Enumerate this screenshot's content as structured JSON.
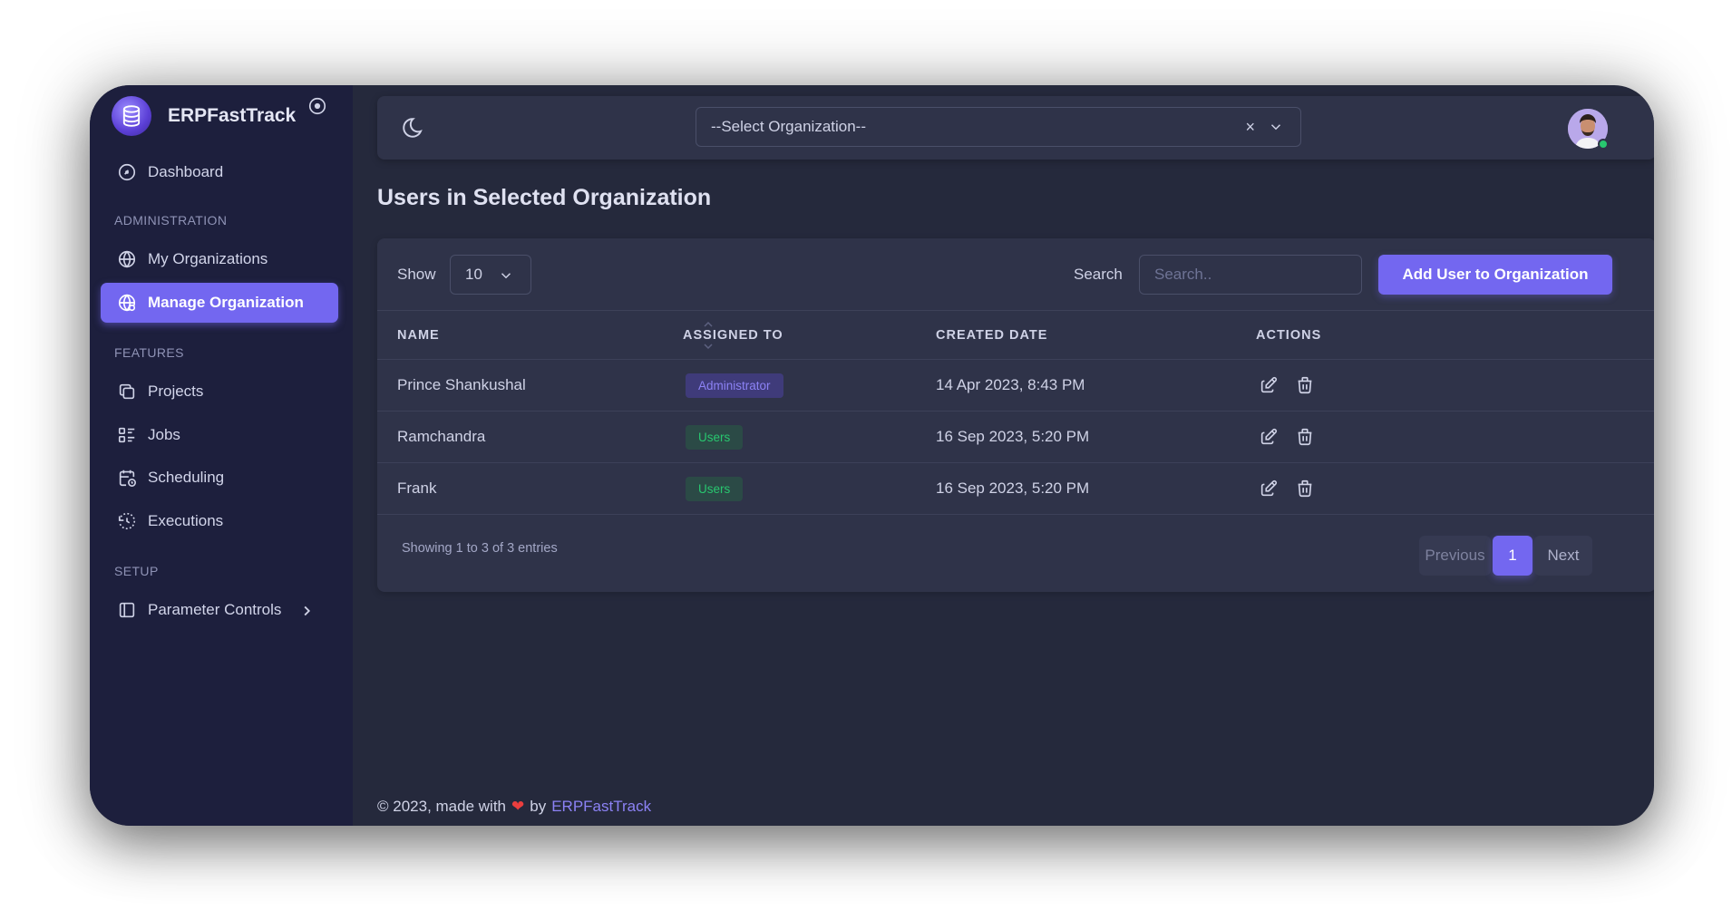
{
  "brand": {
    "name": "ERPFastTrack"
  },
  "sidebar": {
    "items": [
      {
        "label": "Dashboard"
      },
      {
        "label": "My Organizations"
      },
      {
        "label": "Manage Organization"
      },
      {
        "label": "Projects"
      },
      {
        "label": "Jobs"
      },
      {
        "label": "Scheduling"
      },
      {
        "label": "Executions"
      },
      {
        "label": "Parameter Controls"
      }
    ],
    "sections": {
      "administration": "ADMINISTRATION",
      "features": "FEATURES",
      "setup": "SETUP"
    }
  },
  "topbar": {
    "org_select_placeholder": "--Select Organization--",
    "clear_symbol": "×"
  },
  "page": {
    "title": "Users in Selected Organization"
  },
  "controls": {
    "show_label": "Show",
    "page_size": "10",
    "search_label": "Search",
    "search_placeholder": "Search..",
    "add_button": "Add User to Organization"
  },
  "table": {
    "headers": [
      "NAME",
      "ASSIGNED TO",
      "CREATED DATE",
      "ACTIONS"
    ],
    "rows": [
      {
        "name": "Prince Shankushal",
        "assigned": "Administrator",
        "created": "14 Apr 2023, 8:43 PM"
      },
      {
        "name": "Ramchandra",
        "assigned": "Users",
        "created": "16 Sep 2023, 5:20 PM"
      },
      {
        "name": "Frank",
        "assigned": "Users",
        "created": "16 Sep 2023, 5:20 PM"
      }
    ]
  },
  "pagination": {
    "info": "Showing 1 to 3 of 3 entries",
    "previous": "Previous",
    "current": "1",
    "next": "Next"
  },
  "footer": {
    "text": "© 2023, made with",
    "heart": "❤",
    "by": "by",
    "link": "ERPFastTrack"
  },
  "colors": {
    "accent": "#7367f0",
    "sidebar_bg": "#1d1f3d",
    "content_bg": "#25293c",
    "card_bg": "#2f3349",
    "success": "#28c76f"
  }
}
